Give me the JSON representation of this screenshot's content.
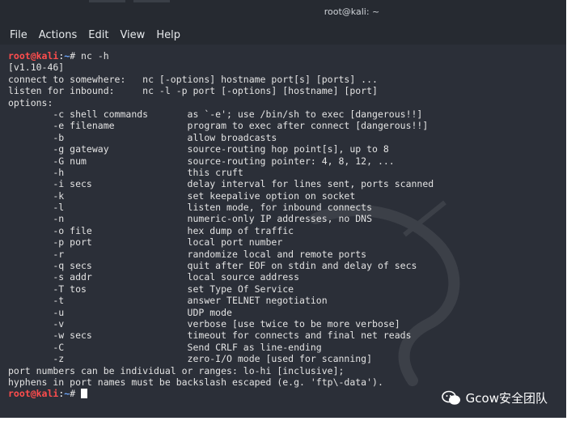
{
  "window": {
    "title": "root@kali: ~"
  },
  "menu": [
    "File",
    "Actions",
    "Edit",
    "View",
    "Help"
  ],
  "prompt": {
    "user": "root@kali",
    "sep": ":",
    "path": "~",
    "symbol": "# "
  },
  "first_command": "nc -h",
  "output_lines": [
    "[v1.10-46]",
    "connect to somewhere:   nc [-options] hostname port[s] [ports] ...",
    "listen for inbound:     nc -l -p port [-options] [hostname] [port]",
    "options:",
    "        -c shell commands       as `-e'; use /bin/sh to exec [dangerous!!]",
    "        -e filename             program to exec after connect [dangerous!!]",
    "        -b                      allow broadcasts",
    "        -g gateway              source-routing hop point[s], up to 8",
    "        -G num                  source-routing pointer: 4, 8, 12, ...",
    "        -h                      this cruft",
    "        -i secs                 delay interval for lines sent, ports scanned",
    "        -k                      set keepalive option on socket",
    "        -l                      listen mode, for inbound connects",
    "        -n                      numeric-only IP addresses, no DNS",
    "        -o file                 hex dump of traffic",
    "        -p port                 local port number",
    "        -r                      randomize local and remote ports",
    "        -q secs                 quit after EOF on stdin and delay of secs",
    "        -s addr                 local source address",
    "        -T tos                  set Type Of Service",
    "        -t                      answer TELNET negotiation",
    "        -u                      UDP mode",
    "        -v                      verbose [use twice to be more verbose]",
    "        -w secs                 timeout for connects and final net reads",
    "        -C                      Send CRLF as line-ending",
    "        -z                      zero-I/O mode [used for scanning]",
    "port numbers can be individual or ranges: lo-hi [inclusive];",
    "hyphens in port names must be backslash escaped (e.g. 'ftp\\-data')."
  ],
  "watermark": "Gcow安全团队",
  "colors": {
    "terminal_bg": "#2b2f38",
    "prompt_user": "#ff4d4d",
    "prompt_path": "#6ea8ff",
    "text": "#e3e3e3"
  }
}
